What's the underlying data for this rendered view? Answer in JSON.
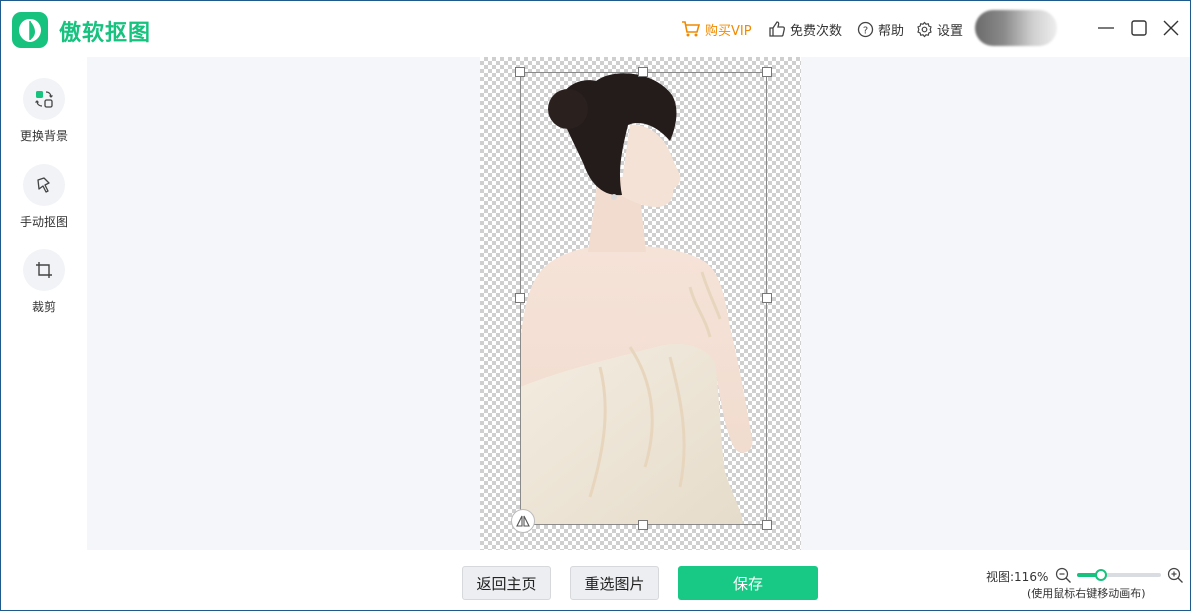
{
  "app": {
    "title": "傲软抠图"
  },
  "header": {
    "vip_label": "购买VIP",
    "free_label": "免费次数",
    "help_label": "帮助",
    "settings_label": "设置"
  },
  "sidebar": {
    "items": [
      {
        "label": "更换背景",
        "icon": "swap-background-icon"
      },
      {
        "label": "手动抠图",
        "icon": "manual-cutout-icon"
      },
      {
        "label": "裁剪",
        "icon": "crop-icon"
      }
    ]
  },
  "footer": {
    "home_label": "返回主页",
    "reselect_label": "重选图片",
    "save_label": "保存",
    "zoom_text": "视图:116%",
    "zoom_value": 0.28,
    "zoom_hint": "(使用鼠标右键移动画布)"
  },
  "colors": {
    "accent": "#17c27e",
    "vip": "#f08a00",
    "save": "#17c984"
  }
}
